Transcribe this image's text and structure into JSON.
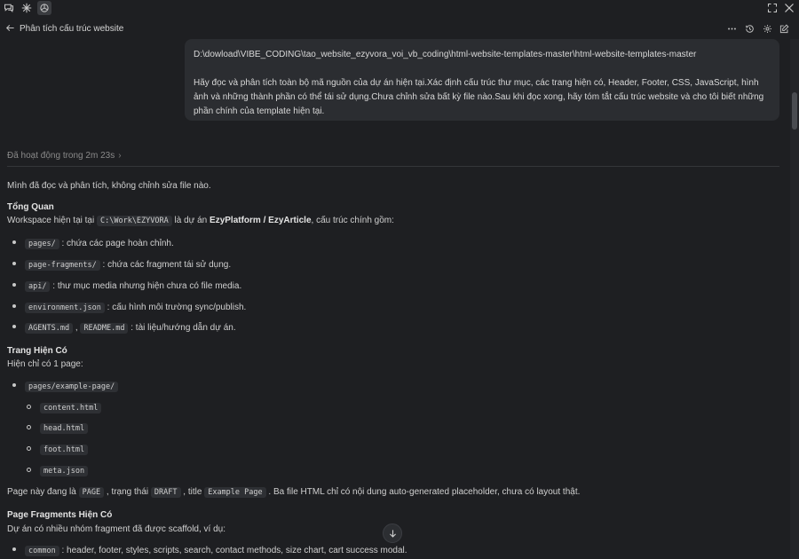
{
  "header": {
    "title": "Phân tích cấu trúc website"
  },
  "message": {
    "path": "D:\\dowload\\VIBE_CODING\\tao_website_ezyvora_voi_vb_coding\\html-website-templates-master\\html-website-templates-master",
    "body": "Hãy đọc và phân tích toàn bộ mã nguồn của dự án hiện tại.Xác định cấu trúc thư mục, các trang hiện có, Header, Footer, CSS, JavaScript, hình ảnh và những thành phần có thể tái sử dụng.Chưa chỉnh sửa bất kỳ file nào.Sau khi đọc xong, hãy tóm tắt cấu trúc website và cho tôi biết những phần chính của template hiện tại."
  },
  "activity": "Đã hoạt động trong 2m 23s",
  "response": {
    "intro": "Mình đã đọc và phân tích, không chỉnh sửa file nào.",
    "s1_title": "Tổng Quan",
    "s1_pre": "Workspace hiện tại tại ",
    "s1_code": "C:\\Work\\EZYVORA",
    "s1_mid": " là dự án ",
    "s1_bold": "EzyPlatform / EzyArticle",
    "s1_post": ", cấu trúc chính gồm:",
    "b1_code": "pages/",
    "b1_text": " : chứa các page hoàn chỉnh.",
    "b2_code": "page-fragments/",
    "b2_text": " : chứa các fragment tái sử dụng.",
    "b3_code": "api/",
    "b3_text": " : thư mục media nhưng hiện chưa có file media.",
    "b4_code": "environment.json",
    "b4_text": " : cấu hình môi trường sync/publish.",
    "b5_code1": "AGENTS.md",
    "b5_sep": " , ",
    "b5_code2": "README.md",
    "b5_text": " : tài liệu/hướng dẫn dự án.",
    "s2_title": "Trang Hiện Có",
    "s2_text": "Hiện chỉ có 1 page:",
    "s2_bullet": "pages/example-page/",
    "s2_sub": [
      "content.html",
      "head.html",
      "foot.html",
      "meta.json"
    ],
    "s2_after_1": "Page này đang là ",
    "s2_after_c1": "PAGE",
    "s2_after_2": " , trạng thái ",
    "s2_after_c2": "DRAFT",
    "s2_after_3": " , title ",
    "s2_after_c3": "Example Page",
    "s2_after_4": " . Ba file HTML chỉ có nội dung auto-generated placeholder, chưa có layout thật.",
    "s3_title": "Page Fragments Hiện Có",
    "s3_text": "Dự án có nhiều nhóm fragment đã được scaffold, ví dụ:",
    "s3_b1_code": "common",
    "s3_b1_text": " : header, footer, styles, scripts, search, contact methods, size chart, cart success modal."
  }
}
